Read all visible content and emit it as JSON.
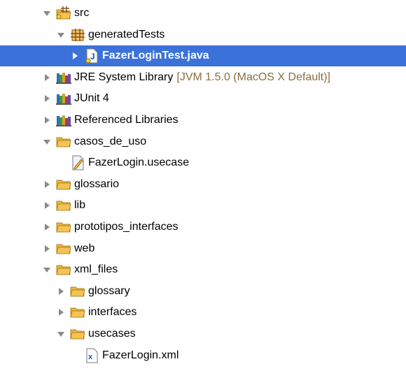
{
  "tree": {
    "rows": [
      {
        "label": "src",
        "icon": "source-package-folder-icon",
        "twisty": "expanded",
        "indent": 0
      },
      {
        "label": "generatedTests",
        "icon": "package-icon",
        "twisty": "expanded",
        "indent": 1
      },
      {
        "label": "FazerLoginTest.java",
        "icon": "java-file-icon",
        "twisty": "collapsed",
        "indent": 2,
        "selected": true
      },
      {
        "label": "JRE System Library",
        "suffix": "[JVM 1.5.0 (MacOS X Default)]",
        "icon": "library-icon",
        "twisty": "collapsed",
        "indent": 0
      },
      {
        "label": "JUnit 4",
        "icon": "library-icon",
        "twisty": "collapsed",
        "indent": 0
      },
      {
        "label": "Referenced Libraries",
        "icon": "library-icon",
        "twisty": "collapsed",
        "indent": 0
      },
      {
        "label": "casos_de_uso",
        "icon": "folder-icon",
        "twisty": "expanded",
        "indent": 0
      },
      {
        "label": "FazerLogin.usecase",
        "icon": "usecase-file-icon",
        "twisty": "none",
        "indent": 1
      },
      {
        "label": "glossario",
        "icon": "folder-icon",
        "twisty": "collapsed",
        "indent": 0
      },
      {
        "label": "lib",
        "icon": "folder-icon",
        "twisty": "collapsed",
        "indent": 0
      },
      {
        "label": "prototipos_interfaces",
        "icon": "folder-icon",
        "twisty": "collapsed",
        "indent": 0
      },
      {
        "label": "web",
        "icon": "folder-icon",
        "twisty": "collapsed",
        "indent": 0
      },
      {
        "label": "xml_files",
        "icon": "folder-icon",
        "twisty": "expanded",
        "indent": 0
      },
      {
        "label": "glossary",
        "icon": "folder-icon",
        "twisty": "collapsed",
        "indent": 1
      },
      {
        "label": "interfaces",
        "icon": "folder-icon",
        "twisty": "collapsed",
        "indent": 1
      },
      {
        "label": "usecases",
        "icon": "folder-icon",
        "twisty": "expanded",
        "indent": 1
      },
      {
        "label": "FazerLogin.xml",
        "icon": "xml-file-icon",
        "twisty": "none",
        "indent": 2
      }
    ]
  },
  "colors": {
    "selection": "#3b72d9",
    "folder": "#f3c453",
    "twisty": "#8a8a8a",
    "muted_text": "#8a6f3c"
  }
}
